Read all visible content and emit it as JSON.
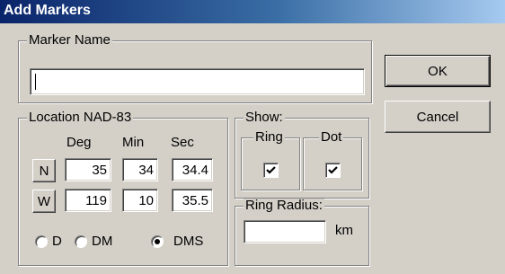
{
  "window": {
    "title": "Add Markers"
  },
  "marker_name": {
    "legend": "Marker Name",
    "value": ""
  },
  "buttons": {
    "ok": "OK",
    "cancel": "Cancel"
  },
  "location": {
    "legend": "Location NAD-83",
    "headers": {
      "deg": "Deg",
      "min": "Min",
      "sec": "Sec"
    },
    "lat": {
      "dir": "N",
      "deg": "35",
      "min": "34",
      "sec": "34.4"
    },
    "lon": {
      "dir": "W",
      "deg": "119",
      "min": "10",
      "sec": "35.5"
    },
    "format": {
      "options": [
        "D",
        "DM",
        "DMS"
      ],
      "selected": "DMS"
    }
  },
  "show": {
    "legend": "Show:",
    "ring": {
      "label": "Ring",
      "checked": true
    },
    "dot": {
      "label": "Dot",
      "checked": true
    }
  },
  "ring_radius": {
    "legend": "Ring Radius:",
    "value": "",
    "unit": "km"
  }
}
